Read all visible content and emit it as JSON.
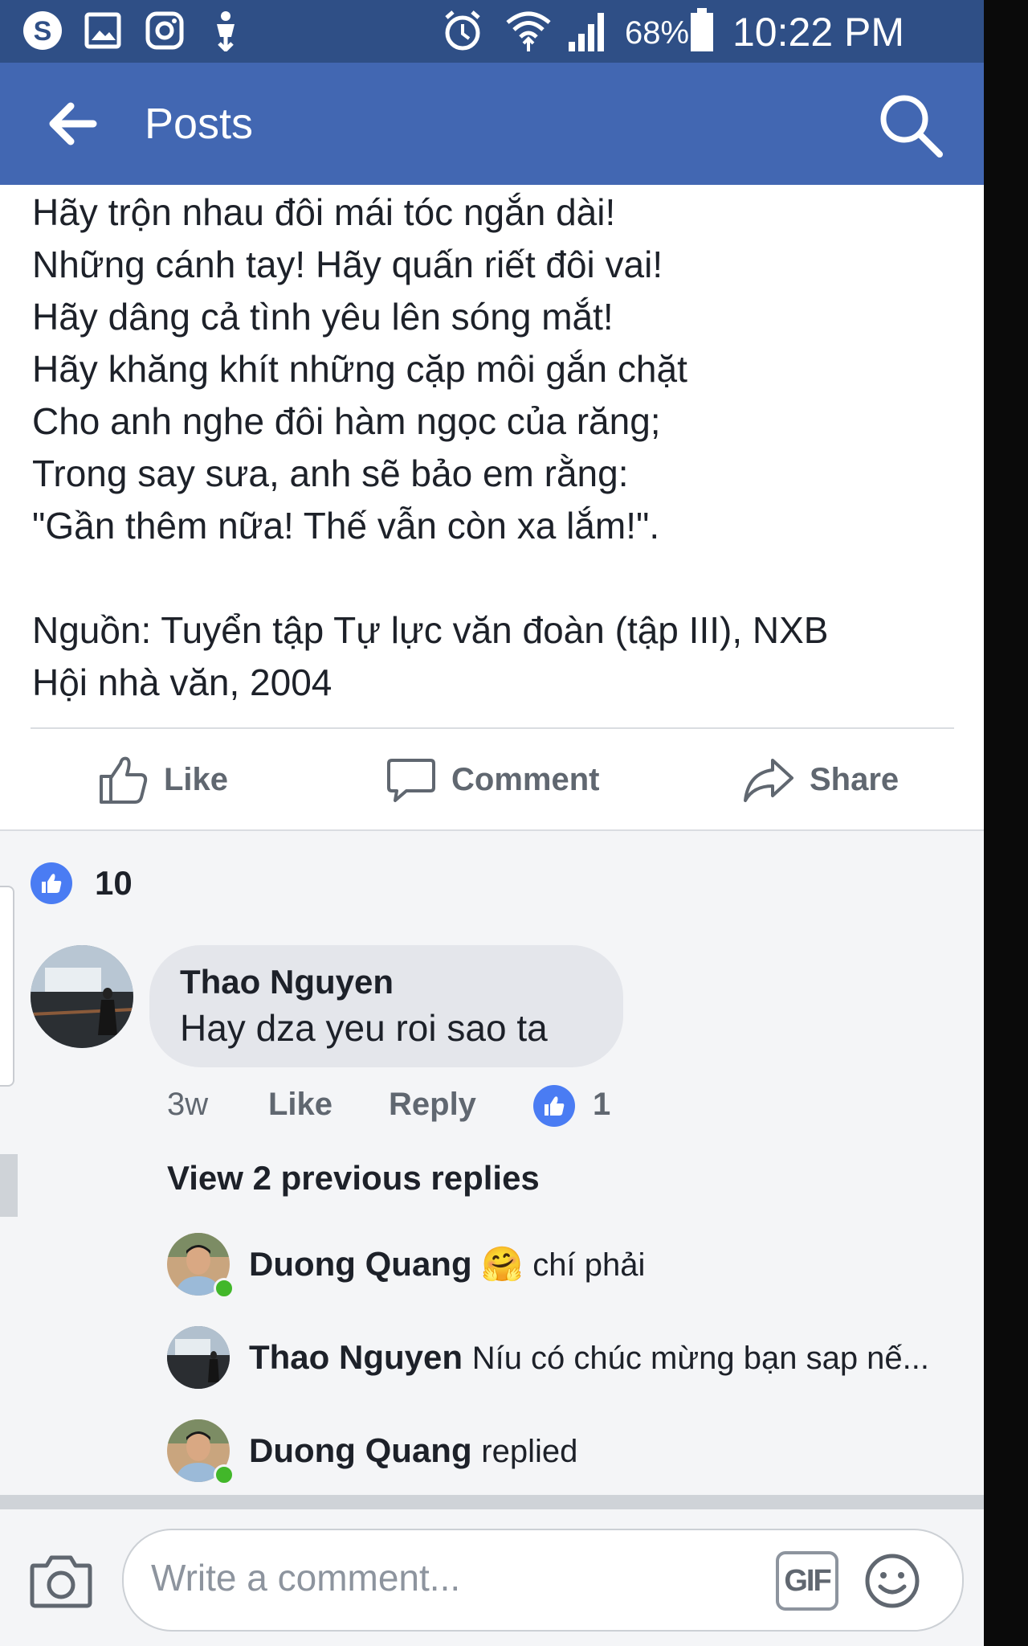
{
  "status_bar": {
    "battery": "68%",
    "time": "10:22 PM"
  },
  "app_bar": {
    "title": "Posts"
  },
  "post": {
    "lines": [
      "Hãy trộn nhau đôi mái tóc ngắn dài!",
      "Những cánh tay! Hãy quấn riết đôi vai!",
      "Hãy dâng cả tình yêu lên sóng mắt!",
      "Hãy khăng khít những cặp môi gắn chặt",
      "Cho anh nghe đôi hàm ngọc của răng;",
      "Trong say sưa, anh sẽ bảo em rằng:",
      "\"Gần thêm nữa! Thế vẫn còn xa lắm!\"."
    ],
    "source_line1": "Nguồn: Tuyển tập Tự lực văn đoàn (tập III), NXB",
    "source_line2": "Hội nhà văn, 2004"
  },
  "actions": {
    "like": "Like",
    "comment": "Comment",
    "share": "Share"
  },
  "reactions": {
    "count": "10"
  },
  "comment": {
    "author": "Thao Nguyen",
    "text": "Hay dza yeu roi sao ta",
    "age": "3w",
    "like_label": "Like",
    "reply_label": "Reply",
    "like_count": "1"
  },
  "view_previous": "View 2 previous replies",
  "replies": [
    {
      "author": "Duong Quang",
      "emoji": "🤗",
      "text": "chí phải"
    },
    {
      "author": "Thao Nguyen",
      "emoji": "",
      "text": "Níu có chúc mừng bạn sap nế..."
    },
    {
      "author": "Duong Quang",
      "emoji": "",
      "text": "replied"
    }
  ],
  "composer": {
    "placeholder": "Write a comment...",
    "gif_label": "GIF"
  },
  "colors": {
    "status_bar": "#2f4f86",
    "app_bar": "#4267b2",
    "like_blue": "#4a7cf3",
    "online_green": "#42b72a"
  }
}
